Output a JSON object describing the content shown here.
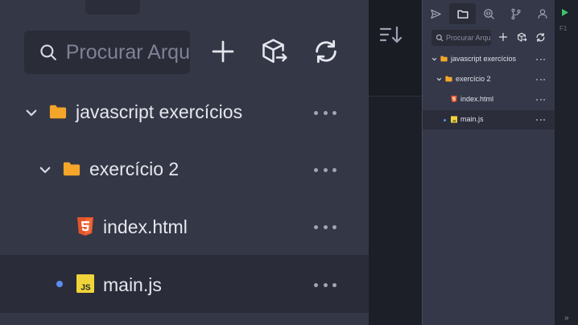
{
  "zoom": {
    "search": {
      "placeholder": "Procurar Arqu",
      "icon": "search-icon"
    },
    "toolbar": [
      "plus-icon",
      "cube-export-icon",
      "refresh-icon"
    ],
    "tree": [
      {
        "label": "javascript exercícios",
        "type": "folder",
        "expanded": true
      },
      {
        "label": "exercício 2",
        "type": "folder",
        "expanded": true
      },
      {
        "label": "index.html",
        "type": "html-file"
      },
      {
        "label": "main.js",
        "type": "js-file",
        "modified": true,
        "selected": true
      }
    ]
  },
  "side": {
    "tabs": [
      "send-icon",
      "folder-icon",
      "search-code-icon",
      "git-branch-icon",
      "user-icon"
    ],
    "active_tab": 1,
    "search": {
      "placeholder": "Procurar Arqu"
    },
    "tree": [
      {
        "label": "javascript exercícios"
      },
      {
        "label": "exercício 2"
      },
      {
        "label": "index.html"
      },
      {
        "label": "main.js",
        "selected": true
      }
    ]
  },
  "right": {
    "shortcut": "F1",
    "collapse": "»"
  },
  "colors": {
    "folder": "#f4a62a",
    "html5": "#e4562a",
    "js": "#f0d43a",
    "accent_dot": "#5b8def",
    "run": "#3ec46d"
  }
}
